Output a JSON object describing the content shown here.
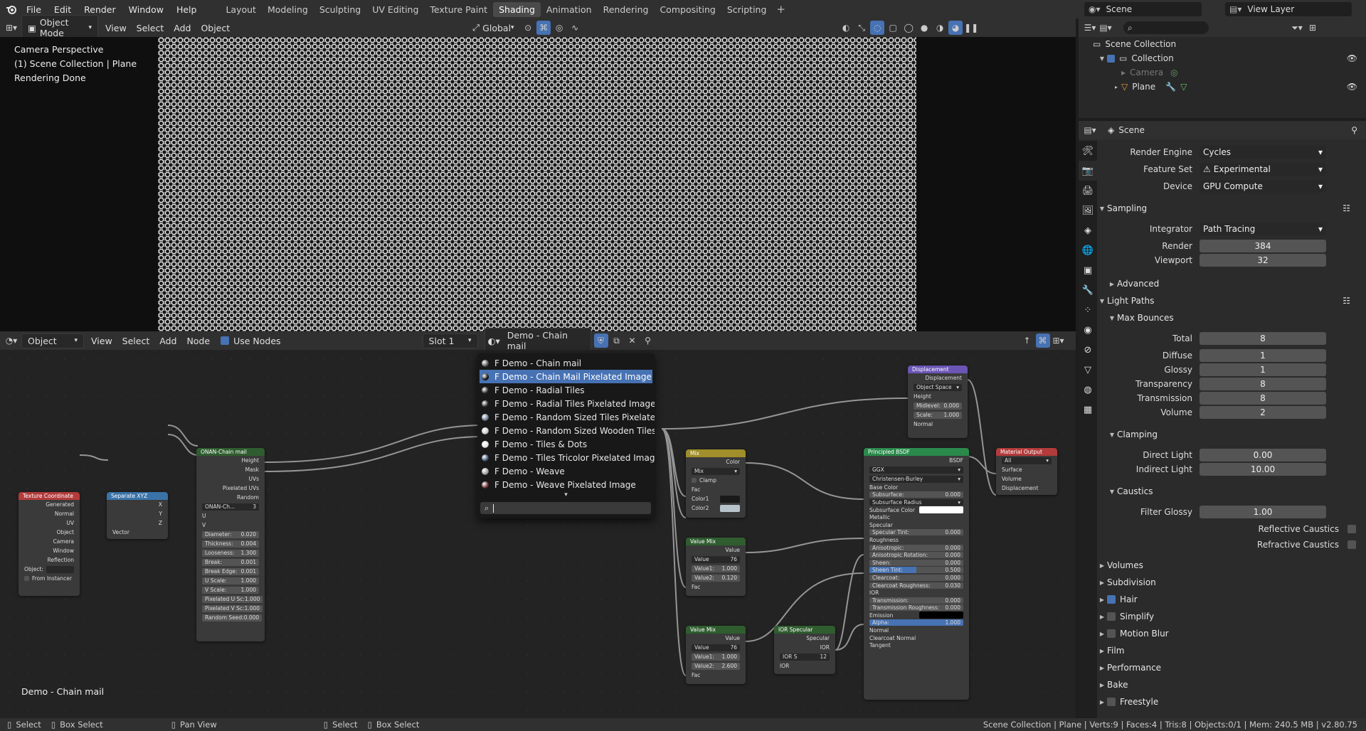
{
  "topbar": {
    "menus": [
      "File",
      "Edit",
      "Render",
      "Window",
      "Help"
    ],
    "workspaces": [
      "Layout",
      "Modeling",
      "Sculpting",
      "UV Editing",
      "Texture Paint",
      "Shading",
      "Animation",
      "Rendering",
      "Compositing",
      "Scripting"
    ],
    "active_workspace": "Shading",
    "scene": "Scene",
    "view_layer": "View Layer"
  },
  "viewport_header": {
    "mode": "Object Mode",
    "menus": [
      "View",
      "Select",
      "Add",
      "Object"
    ],
    "orientation": "Global"
  },
  "viewport": {
    "line1": "Camera Perspective",
    "line2": "(1) Scene Collection | Plane",
    "line3": "Rendering Done"
  },
  "node_header": {
    "type": "Object",
    "menus": [
      "View",
      "Select",
      "Add",
      "Node"
    ],
    "use_nodes": "Use Nodes",
    "slot": "Slot 1",
    "material": "Demo - Chain mail"
  },
  "material_popup": {
    "items": [
      {
        "label": "F Demo - Chain mail",
        "color": "#555555"
      },
      {
        "label": "F Demo - Chain Mail Pixelated Image",
        "color": "#111111",
        "selected": true
      },
      {
        "label": "F Demo - Radial Tiles",
        "color": "#2a2a2a"
      },
      {
        "label": "F Demo - Radial Tiles Pixelated Image",
        "color": "#2a2a2a"
      },
      {
        "label": "F Demo - Random Sized Tiles Pixelated Ima...",
        "color": "#6a7c8f"
      },
      {
        "label": "F Demo - Random Sized Wooden Tiles",
        "color": "#c9c9c9"
      },
      {
        "label": "F Demo - Tiles & Dots",
        "color": "#e5e5e5"
      },
      {
        "label": "F Demo - Tiles Tricolor Pixelated Image",
        "color": "#3a5070"
      },
      {
        "label": "F Demo - Weave",
        "color": "#9a9a9a"
      },
      {
        "label": "F Demo - Weave Pixelated Image",
        "color": "#6a3030"
      }
    ],
    "more": "▾"
  },
  "nodes": {
    "texcoord": {
      "title": "Texture Coordinate",
      "outputs": [
        "Generated",
        "Normal",
        "UV",
        "Object",
        "Camera",
        "Window",
        "Reflection"
      ],
      "object_label": "Object:",
      "from_instancer": "From Instancer"
    },
    "sepxyz": {
      "title": "Separate XYZ",
      "outputs": [
        "X",
        "Y",
        "Z"
      ],
      "input": "Vector"
    },
    "chainmail": {
      "title": "ONAN-Chain mail",
      "outputs": [
        "Height",
        "Mask",
        "UVs",
        "Pixelated UVs",
        "Random"
      ],
      "group": "ONAN-Ch...",
      "group_users": "3",
      "inputs": [
        "U",
        "V"
      ],
      "params": [
        [
          "Diameter:",
          "0.020"
        ],
        [
          "Thickness:",
          "0.004"
        ],
        [
          "Looseness:",
          "1.300"
        ],
        [
          "Break:",
          "0.001"
        ],
        [
          "Break Edge:",
          "0.001"
        ],
        [
          "U Scale:",
          "1.000"
        ],
        [
          "V Scale:",
          "1.000"
        ],
        [
          "Pixelated U Sc:",
          "1.000"
        ],
        [
          "Pixelated V Sc:",
          "1.000"
        ],
        [
          "Random Seed:",
          "0.000"
        ]
      ]
    },
    "mix": {
      "title": "Mix",
      "output": "Color",
      "blend": "Mix",
      "clamp": "Clamp",
      "inputs": [
        "Fac",
        "Color1",
        "Color2"
      ]
    },
    "valuemix1": {
      "title": "Value Mix",
      "output": "Value",
      "group": "Value",
      "users": "76",
      "params": [
        [
          "Value1:",
          "1.000"
        ],
        [
          "Value2:",
          "0.120"
        ]
      ],
      "input": "Fac"
    },
    "valuemix2": {
      "title": "Value Mix",
      "output": "Value",
      "group": "Value",
      "users": "76",
      "params": [
        [
          "Value1:",
          "1.000"
        ],
        [
          "Value2:",
          "2.600"
        ]
      ],
      "input": "Fac"
    },
    "iorspec": {
      "title": "IOR Specular",
      "outputs": [
        "Specular",
        "IOR"
      ],
      "group": "IOR S",
      "users": "12",
      "input": "IOR"
    },
    "displacement": {
      "title": "Displacement",
      "output": "Displacement",
      "space": "Object Space",
      "inputs": [
        "Height"
      ],
      "params": [
        [
          "Midlevel:",
          "0.000"
        ],
        [
          "Scale:",
          "1.000"
        ]
      ],
      "input2": "Normal"
    },
    "bsdf": {
      "title": "Principled BSDF",
      "output": "BSDF",
      "dist": "GGX",
      "sss": "Christensen-Burley",
      "rows": [
        [
          "Base Color",
          ""
        ],
        [
          "Subsurface:",
          "0.000"
        ],
        [
          "Subsurface Radius",
          ""
        ],
        [
          "Subsurface Color",
          ""
        ],
        [
          "Metallic",
          ""
        ],
        [
          "Specular",
          ""
        ],
        [
          "Specular Tint:",
          "0.000"
        ],
        [
          "Roughness",
          ""
        ],
        [
          "Anisotropic:",
          "0.000"
        ],
        [
          "Anisotropic Rotation:",
          "0.000"
        ],
        [
          "Sheen:",
          "0.000"
        ],
        [
          "Sheen Tint:",
          "0.500"
        ],
        [
          "Clearcoat:",
          "0.000"
        ],
        [
          "Clearcoat Roughness:",
          "0.030"
        ],
        [
          "IOR",
          ""
        ],
        [
          "Transmission:",
          "0.000"
        ],
        [
          "Transmission Roughness:",
          "0.000"
        ],
        [
          "Emission",
          ""
        ],
        [
          "Alpha:",
          "1.000"
        ],
        [
          "Normal",
          ""
        ],
        [
          "Clearcoat Normal",
          ""
        ],
        [
          "Tangent",
          ""
        ]
      ]
    },
    "output": {
      "title": "Material Output",
      "target": "All",
      "inputs": [
        "Surface",
        "Volume",
        "Displacement"
      ]
    }
  },
  "node_editor_label": "Demo - Chain mail",
  "outliner": {
    "title": "Scene Collection",
    "items": [
      "Collection",
      "Camera",
      "Plane"
    ]
  },
  "properties": {
    "header": "Scene",
    "render_engine_label": "Render Engine",
    "render_engine": "Cycles",
    "feature_set_label": "Feature Set",
    "feature_set": "Experimental",
    "device_label": "Device",
    "device": "GPU Compute",
    "sampling": "Sampling",
    "integrator_label": "Integrator",
    "integrator": "Path Tracing",
    "render_label": "Render",
    "render": "384",
    "viewport_label": "Viewport",
    "viewport": "32",
    "advanced": "Advanced",
    "light_paths": "Light Paths",
    "max_bounces": "Max Bounces",
    "total_label": "Total",
    "total": "8",
    "diffuse_label": "Diffuse",
    "diffuse": "1",
    "glossy_label": "Glossy",
    "glossy": "1",
    "transparency_label": "Transparency",
    "transparency": "8",
    "transmission_label": "Transmission",
    "transmission": "8",
    "volume_label": "Volume",
    "volume": "2",
    "clamping": "Clamping",
    "direct_label": "Direct Light",
    "direct": "0.00",
    "indirect_label": "Indirect Light",
    "indirect": "10.00",
    "caustics": "Caustics",
    "filter_label": "Filter Glossy",
    "filter": "1.00",
    "refl": "Reflective Caustics",
    "refr": "Refractive Caustics",
    "sections": [
      "Volumes",
      "Subdivision",
      "Hair",
      "Simplify",
      "Motion Blur",
      "Film",
      "Performance",
      "Bake",
      "Freestyle"
    ]
  },
  "statusbar": {
    "left": [
      "Select",
      "Box Select",
      "Pan View",
      "Select",
      "Box Select"
    ],
    "right": "Scene Collection | Plane | Verts:9 | Faces:4 | Tris:8 | Objects:0/1 | Mem: 240.5 MB | v2.80.75"
  }
}
